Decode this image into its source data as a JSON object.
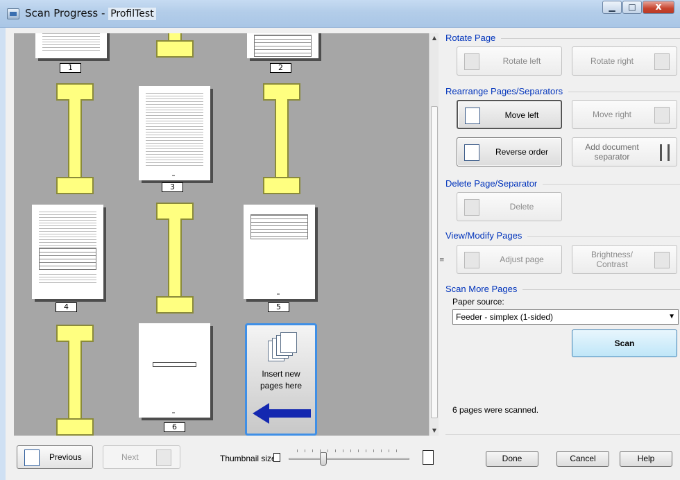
{
  "window": {
    "title": "Scan Progress - ",
    "title_sub": "ProfilTest",
    "minimize": "▁",
    "maximize": "□",
    "close": "x"
  },
  "thumbnails": {
    "page_numbers": [
      "1",
      "2",
      "3",
      "4",
      "5",
      "6"
    ],
    "insert_text": "Insert new pages here"
  },
  "panel": {
    "rotate": {
      "heading": "Rotate Page",
      "left": "Rotate left",
      "right": "Rotate right"
    },
    "rearrange": {
      "heading": "Rearrange Pages/Separators",
      "move_left": "Move left",
      "move_right": "Move right",
      "reverse": "Reverse order",
      "add_separator": "Add document separator"
    },
    "delete": {
      "heading": "Delete Page/Separator",
      "label": "Delete"
    },
    "view": {
      "heading": "View/Modify Pages",
      "adjust": "Adjust page",
      "brightness": "Brightness/ Contrast"
    },
    "scan_more": {
      "heading": "Scan More Pages",
      "paper_source_label": "Paper source:",
      "paper_source_value": "Feeder - simplex (1-sided)",
      "scan": "Scan"
    },
    "status": "6 pages were scanned."
  },
  "bottom": {
    "previous": "Previous",
    "next": "Next",
    "thumbnail_size_label": "Thumbnail size:",
    "thumbnail_size_level": 0.25,
    "done": "Done",
    "cancel": "Cancel",
    "help": "Help"
  },
  "colors": {
    "accent": "#3f8fe6",
    "heading": "#0033bb",
    "separator_fill": "#ffff80"
  },
  "icons": {
    "app": "scanner-icon",
    "insert": "document-stack-icon",
    "insert_arrow": "arrow-left-icon"
  }
}
